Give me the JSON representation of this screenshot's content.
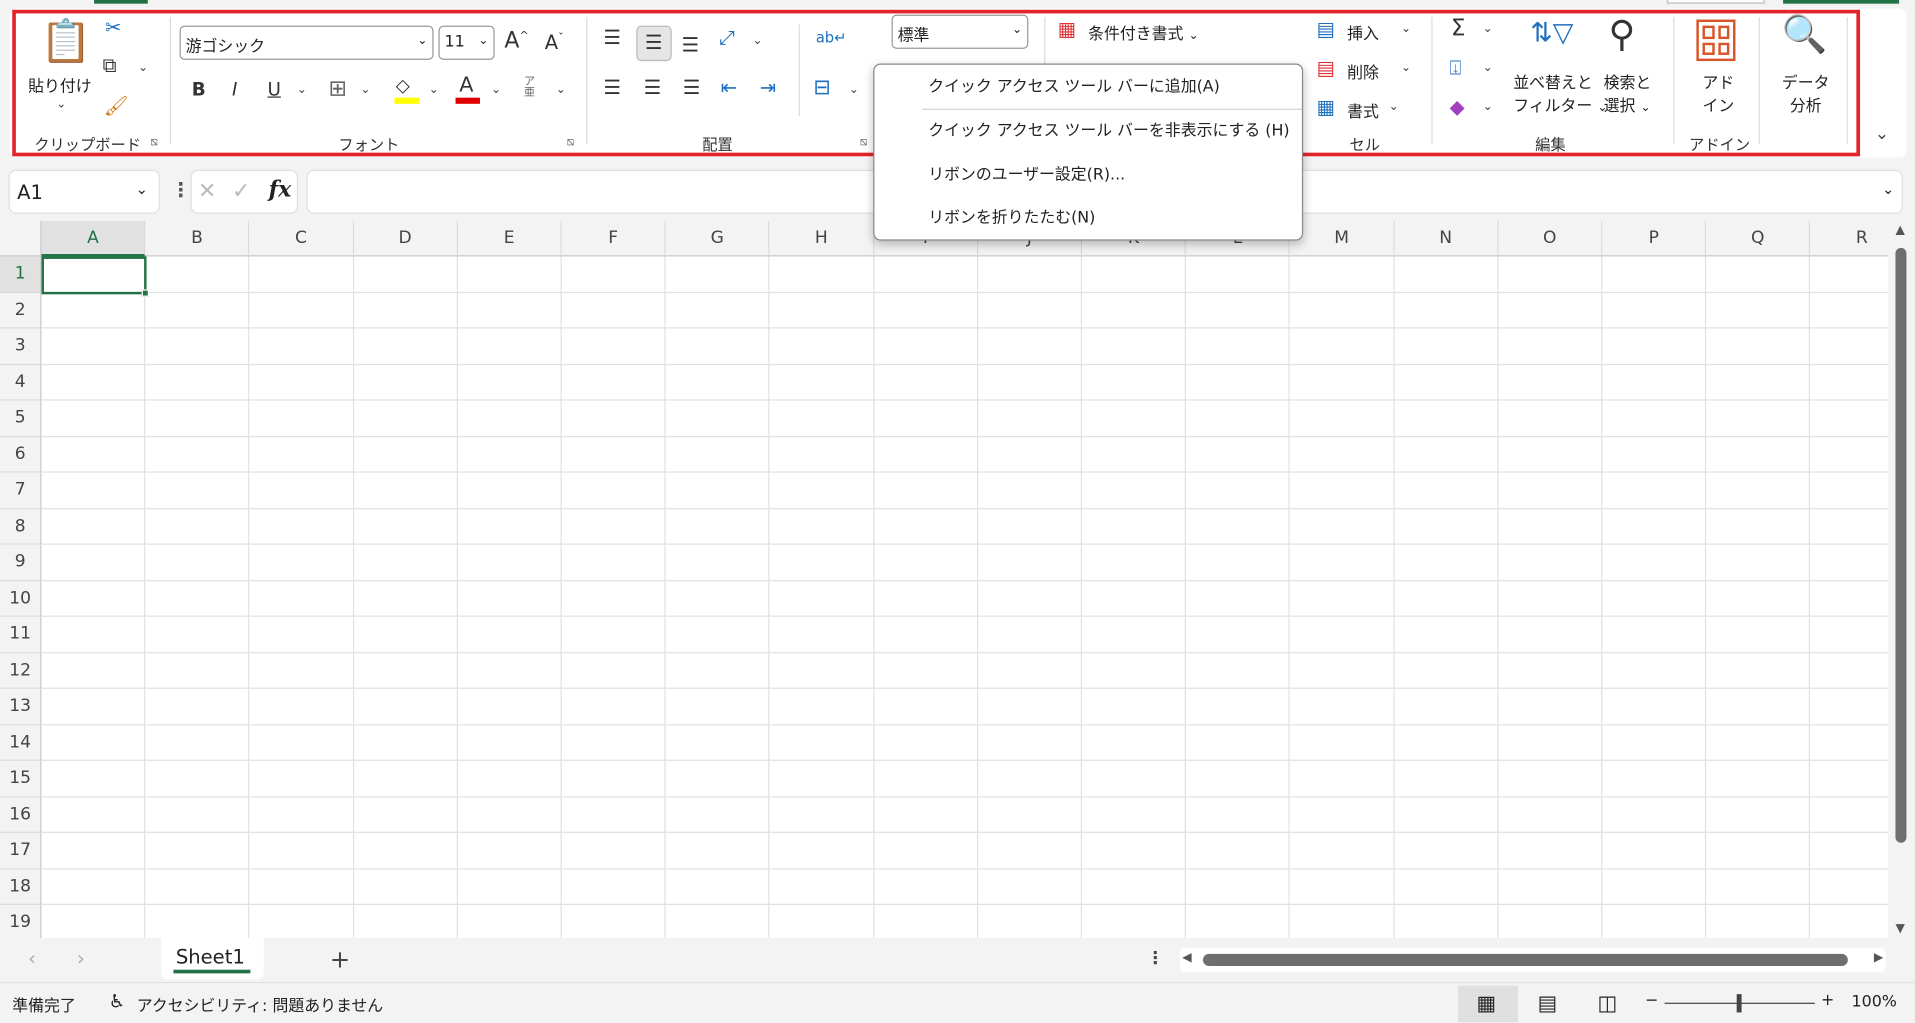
{
  "ribbon": {
    "clipboard": {
      "paste": "貼り付け",
      "label": "クリップボード"
    },
    "font": {
      "font_name": "游ゴシック",
      "font_size": "11",
      "bold": "B",
      "italic": "I",
      "underline": "U",
      "font_color_letter": "A",
      "phonetic": "ア亜",
      "label": "フォント",
      "highlight_color": "#ffff00",
      "font_color": "#e00000"
    },
    "alignment": {
      "label": "配置"
    },
    "number": {
      "format": "標準"
    },
    "styles": {
      "conditional_format": "条件付き書式"
    },
    "cells": {
      "insert": "挿入",
      "delete": "削除",
      "format": "書式",
      "label": "セル"
    },
    "editing": {
      "sort_filter_1": "並べ替えと",
      "sort_filter_2": "フィルター",
      "find_select_1": "検索と",
      "find_select_2": "選択",
      "label": "編集"
    },
    "addins": {
      "addin_1": "アド",
      "addin_2": "イン",
      "label": "アドイン"
    },
    "analysis": {
      "data_analysis_1": "データ",
      "data_analysis_2": "分析"
    }
  },
  "context_menu": {
    "items": [
      "クイック アクセス ツール バーに追加(A)",
      "クイック アクセス ツール バーを非表示にする (H)",
      "リボンのユーザー設定(R)...",
      "リボンを折りたたむ(N)"
    ]
  },
  "formula_bar": {
    "name_box": "A1",
    "fx": "fx",
    "value": ""
  },
  "grid": {
    "columns": [
      "A",
      "B",
      "C",
      "D",
      "E",
      "F",
      "G",
      "H",
      "I",
      "J",
      "K",
      "L",
      "M",
      "N",
      "O",
      "P",
      "Q",
      "R"
    ],
    "rows": [
      "1",
      "2",
      "3",
      "4",
      "5",
      "6",
      "7",
      "8",
      "9",
      "10",
      "11",
      "12",
      "13",
      "14",
      "15",
      "16",
      "17",
      "18",
      "19"
    ],
    "selected_cell": "A1",
    "accent": "#217346"
  },
  "sheets": {
    "tabs": [
      "Sheet1"
    ],
    "add": "+"
  },
  "status": {
    "ready": "準備完了",
    "accessibility": "アクセシビリティ: 問題ありません",
    "zoom": "100%",
    "zoom_minus": "−",
    "zoom_plus": "+"
  }
}
